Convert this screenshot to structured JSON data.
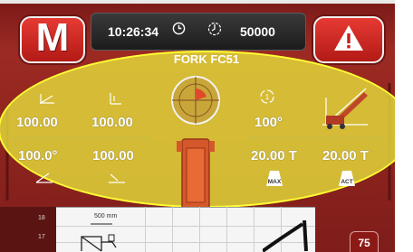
{
  "header": {
    "time": "10:26:34",
    "hour_meter": "50000",
    "logo_letter": "M"
  },
  "overlay_title": "FORK FC51",
  "left_group": {
    "top_left_value": "100.00",
    "top_right_value": "100.00",
    "bottom_left_value": "100.0°",
    "bottom_right_value": "100.00"
  },
  "right_group": {
    "rotation_value": "100°",
    "load_value": "20.00",
    "load_unit": "T",
    "load_max_label": "MAX",
    "actual_load_value": "20.00",
    "actual_load_unit": "T",
    "actual_load_label": "ACT"
  },
  "bottom_panel": {
    "scale_18": "18",
    "scale_17": "17",
    "unit_label": "500 mm",
    "page_badge": "75"
  },
  "colors": {
    "brand_red": "#d32a24",
    "background_dark_red": "#7e1d1a",
    "overlay_yellow": "#e6e13c"
  }
}
